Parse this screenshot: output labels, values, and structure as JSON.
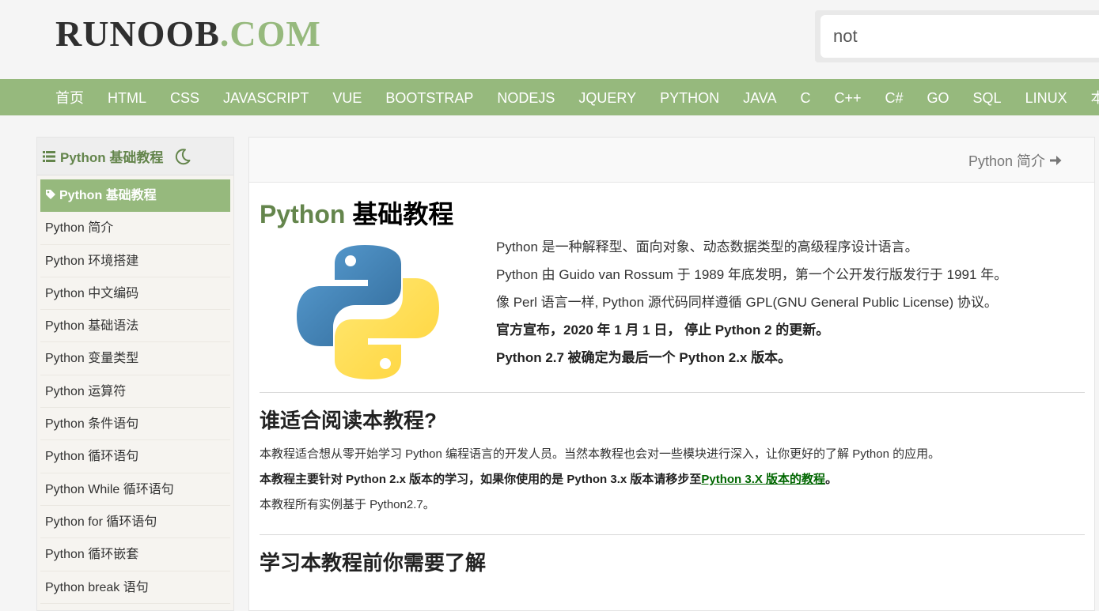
{
  "header": {
    "logo_main": "RUNOOB",
    "logo_dot": ".",
    "logo_com": "COM",
    "search_value": "not"
  },
  "nav": {
    "items": [
      "首页",
      "HTML",
      "CSS",
      "JAVASCRIPT",
      "VUE",
      "BOOTSTRAP",
      "NODEJS",
      "JQUERY",
      "PYTHON",
      "JAVA",
      "C",
      "C++",
      "C#",
      "GO",
      "SQL",
      "LINUX",
      "本"
    ]
  },
  "sidebar": {
    "title": "Python 基础教程",
    "items": [
      {
        "label": "Python 基础教程",
        "active": true
      },
      {
        "label": "Python 简介"
      },
      {
        "label": "Python 环境搭建"
      },
      {
        "label": "Python 中文编码"
      },
      {
        "label": "Python 基础语法"
      },
      {
        "label": "Python 变量类型"
      },
      {
        "label": "Python 运算符"
      },
      {
        "label": "Python 条件语句"
      },
      {
        "label": "Python 循环语句"
      },
      {
        "label": "Python While 循环语句"
      },
      {
        "label": "Python for 循环语句"
      },
      {
        "label": "Python 循环嵌套"
      },
      {
        "label": "Python break 语句"
      }
    ]
  },
  "main": {
    "next_link": "Python 简介",
    "title_accent": "Python",
    "title_rest": " 基础教程",
    "intro": [
      "Python 是一种解释型、面向对象、动态数据类型的高级程序设计语言。",
      "Python 由 Guido van Rossum 于 1989 年底发明，第一个公开发行版发行于 1991 年。",
      "像 Perl 语言一样, Python 源代码同样遵循 GPL(GNU General Public License) 协议。",
      "官方宣布，2020 年 1 月 1 日， 停止 Python 2 的更新。",
      "Python 2.7 被确定为最后一个 Python 2.x 版本。"
    ],
    "section1_title": "谁适合阅读本教程?",
    "section1_p1": "本教程适合想从零开始学习 Python 编程语言的开发人员。当然本教程也会对一些模块进行深入，让你更好的了解 Python 的应用。",
    "section1_p2_prefix": "本教程主要针对 Python 2.x 版本的学习，如果你使用的是 Python 3.x 版本请移步至",
    "section1_p2_link": "Python 3.X 版本的教程",
    "section1_p2_suffix": "。",
    "section1_p3": "本教程所有实例基于 Python2.7。",
    "section2_title": "学习本教程前你需要了解"
  },
  "colors": {
    "brand_green": "#96b97d",
    "accent_dark_green": "#64854c",
    "link_green": "#006600"
  }
}
